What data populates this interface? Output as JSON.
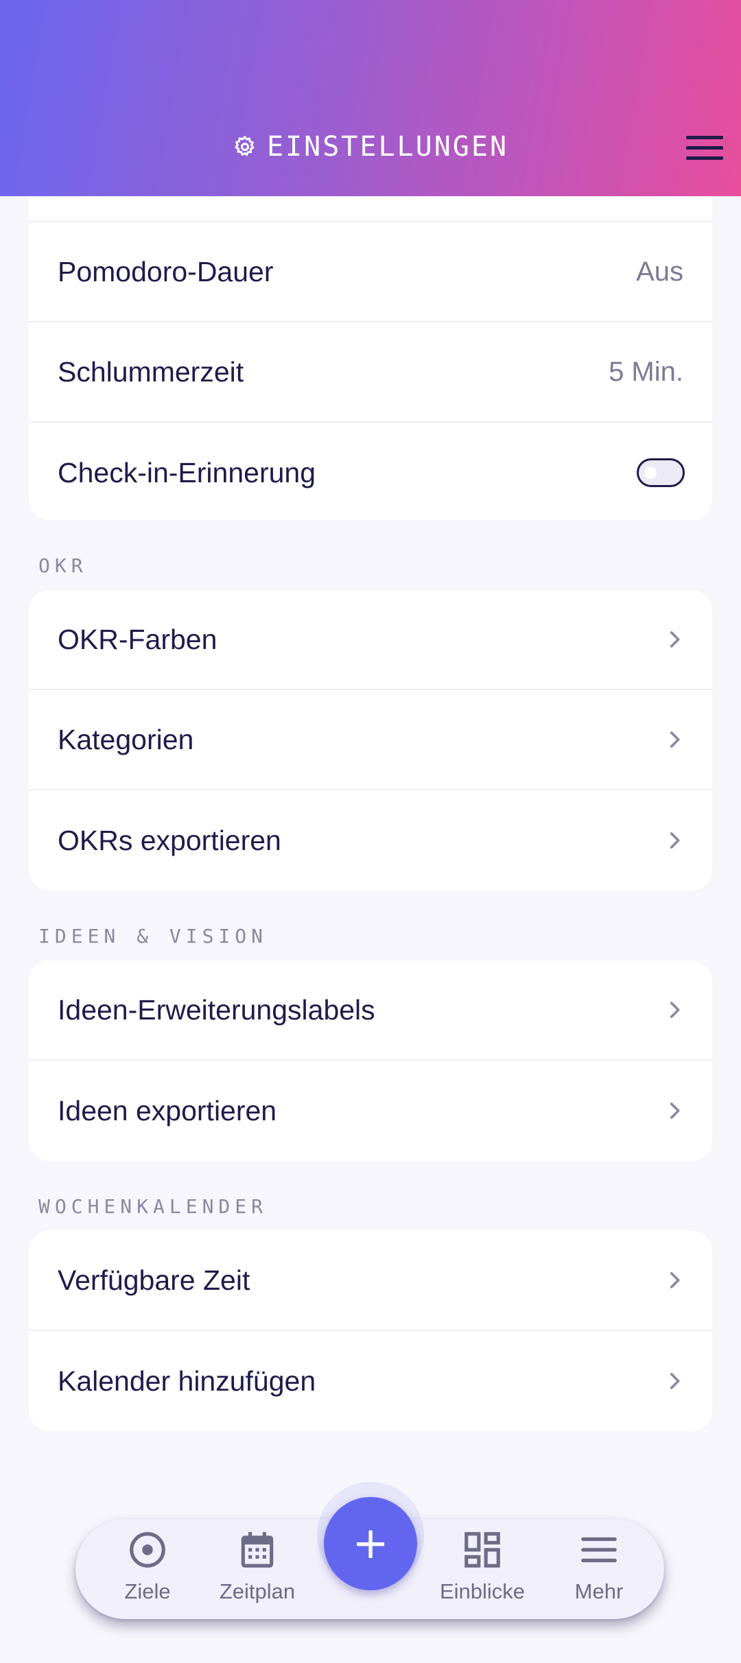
{
  "header": {
    "title": "EINSTELLUNGEN",
    "title_icon": "gear-icon",
    "menu_icon": "hamburger-menu-icon"
  },
  "general_card": {
    "rows": [
      {
        "label": "Pomodoro-Dauer",
        "value": "Aus"
      },
      {
        "label": "Schlummerzeit",
        "value": "5 Min."
      },
      {
        "label": "Check-in-Erinnerung",
        "toggle": false
      }
    ]
  },
  "sections": [
    {
      "label": "OKR",
      "items": [
        "OKR-Farben",
        "Kategorien",
        "OKRs exportieren"
      ]
    },
    {
      "label": "IDEEN & VISION",
      "items": [
        "Ideen-Erweiterungslabels",
        "Ideen exportieren"
      ]
    },
    {
      "label": "WOCHENKALENDER",
      "items": [
        "Verfügbare Zeit",
        "Kalender hinzufügen"
      ]
    }
  ],
  "bottom_nav": {
    "items": [
      {
        "label": "Ziele",
        "icon": "target-icon"
      },
      {
        "label": "Zeitplan",
        "icon": "calendar-icon"
      },
      {
        "label": "Einblicke",
        "icon": "dashboard-icon"
      },
      {
        "label": "Mehr",
        "icon": "menu-icon"
      }
    ],
    "fab_icon": "plus-icon",
    "fab_label": "+"
  },
  "colors": {
    "accent": "#6266ef",
    "gradient_start": "#6b67ef",
    "gradient_end": "#e84e9c",
    "text": "#1f1b4a"
  }
}
